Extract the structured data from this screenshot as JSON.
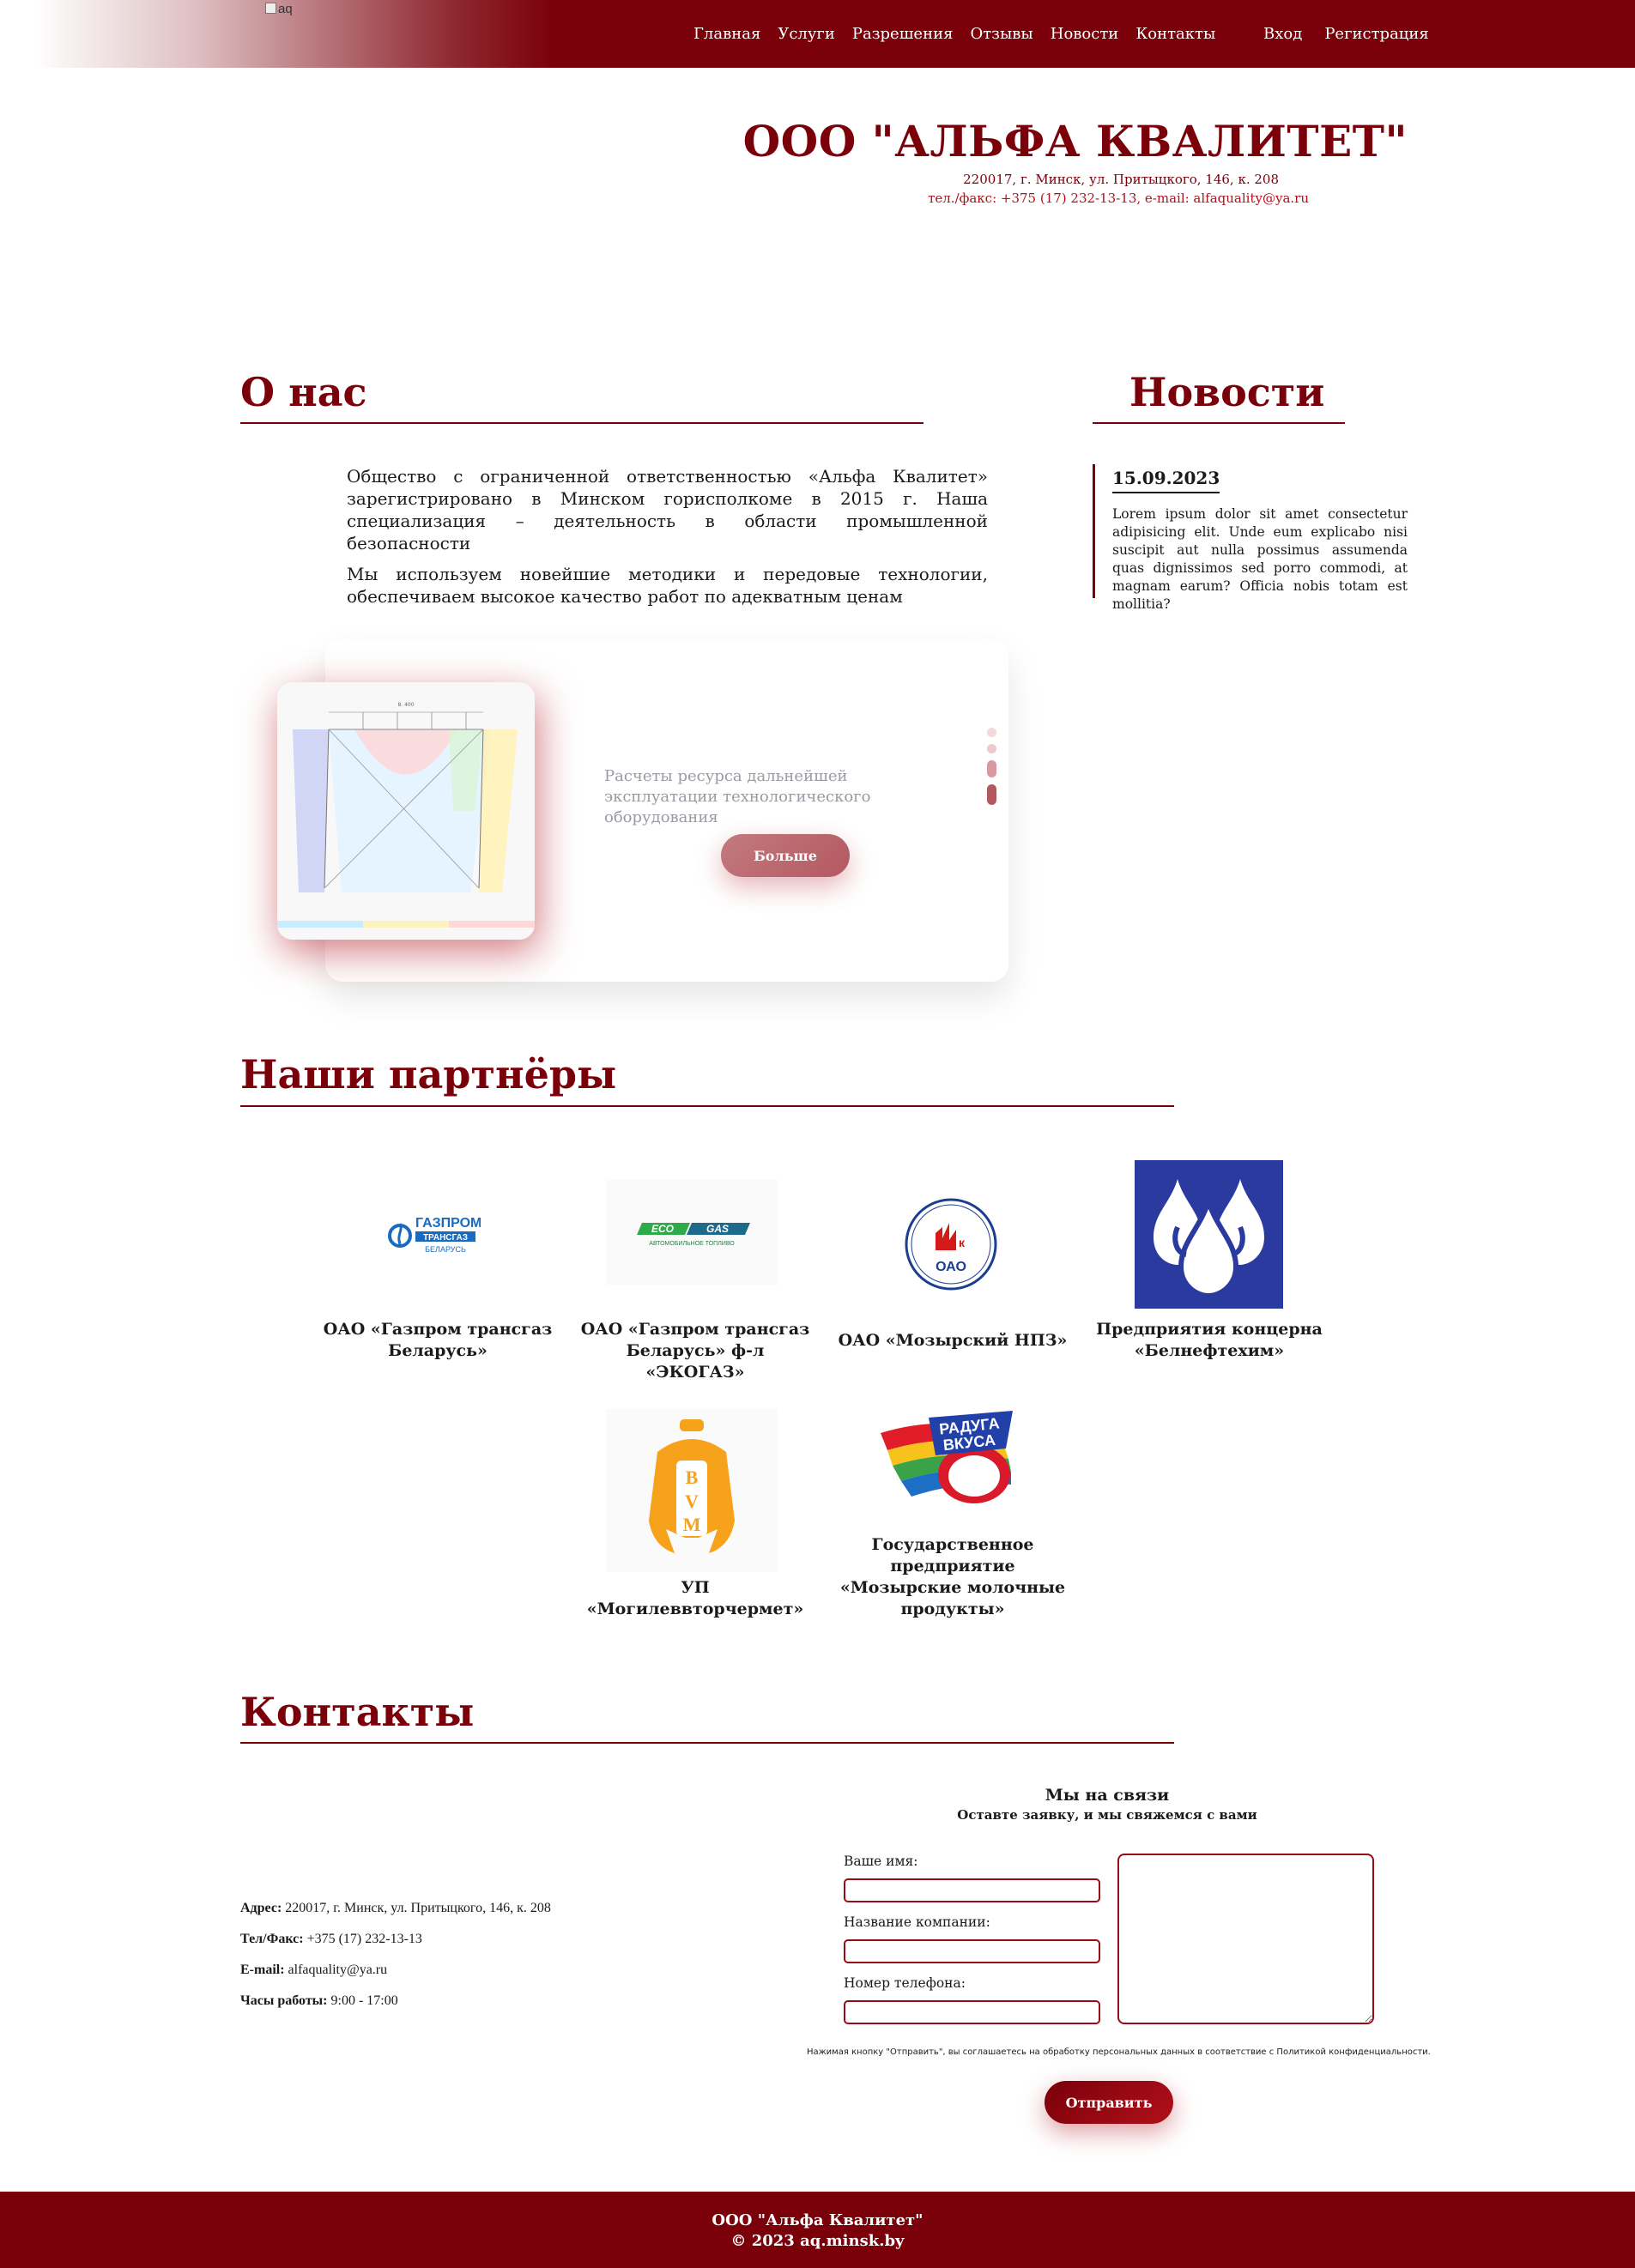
{
  "nav": {
    "logo_alt": "aq",
    "menu": [
      "Главная",
      "Услуги",
      "Разрешения",
      "Отзывы",
      "Новости",
      "Контакты"
    ],
    "login": "Вход",
    "register": "Регистрация"
  },
  "header": {
    "company": "ООО \"АЛЬФА КВАЛИТЕТ\"",
    "address": "220017, г. Минск, ул. Притыцкого, 146, к. 208",
    "contacts": "тел./факс: +375 (17) 232-13-13, e-mail: alfaquality@ya.ru"
  },
  "about": {
    "title": "О нас",
    "p1": "Общество с ограниченной ответственностью «Альфа Квалитет» зарегистрировано в Минском горисполкоме в 2015 г. Наша специализация – деятельность в области промышленной безопасности",
    "p2": "Мы используем новейшие методики и передовые технологии, обеспечиваем высокое качество работ по адекватным ценам"
  },
  "news": {
    "title": "Новости",
    "date": "15.09.2023",
    "text": "Lorem ipsum dolor sit amet consectetur adipisicing elit. Unde eum explicabo nisi suscipit aut nulla possimus assumenda quas dignissimos sed porro commodi, at magnam earum? Officia nobis totam est mollitia?"
  },
  "slider": {
    "text": "Расчеты ресурса дальнейшей эксплуатации технологического оборудования",
    "button": "Больше",
    "image_label": "8. 400"
  },
  "partners": {
    "title": "Наши партнёры",
    "items": [
      {
        "name": "ОАО «Газпром трансгаз Беларусь»",
        "logo_text": [
          "ГАЗПРОМ",
          "ТРАНСГАЗ",
          "БЕЛАРУСЬ"
        ]
      },
      {
        "name": "ОАО «Газпром трансгаз Беларусь» ф-л «ЭКОГАЗ»",
        "logo_text": [
          "ECO",
          "GAS",
          "АВТОМОБИЛЬНОЕ ТОПЛИВО"
        ]
      },
      {
        "name": "ОАО «Мозырский НПЗ»",
        "logo_text": [
          "ОАО"
        ]
      },
      {
        "name": "Предприятия концерна «Белнефтехим»",
        "logo_text": []
      },
      {
        "name": "УП «Могилеввторчермет»",
        "logo_text": [
          "B",
          "V",
          "M"
        ]
      },
      {
        "name": "Государственное предприятие «Мозырские молочные продукты»",
        "logo_text": [
          "РАДУГА",
          "ВКУСА"
        ]
      }
    ]
  },
  "contacts": {
    "title": "Контакты",
    "address_label": "Адрес:",
    "address": "220017, г. Минск, ул. Притыцкого, 146, к. 208",
    "phone_label": "Тел/Факс:",
    "phone": "+375 (17) 232-13-13",
    "email_label": "E-mail:",
    "email": "alfaquality@ya.ru",
    "hours_label": "Часы работы:",
    "hours": "9:00 - 17:00"
  },
  "form": {
    "title": "Мы на связи",
    "subtitle": "Оставте заявку, и мы свяжемся с вами",
    "name_label": "Ваше имя:",
    "company_label": "Название компании:",
    "phone_label": "Номер телефона:",
    "note": "Нажимая кнопку \"Отправить\", вы соглашаетесь на обработку персональных данных в соответствие с Политикой конфиденциальности.",
    "submit": "Отправить"
  },
  "footer": {
    "line1": "ООО \"Альфа Квалитет\"",
    "line2": "© 2023 aq.minsk.by"
  },
  "colors": {
    "brand": "#7a000a",
    "accent": "#b0101a"
  }
}
